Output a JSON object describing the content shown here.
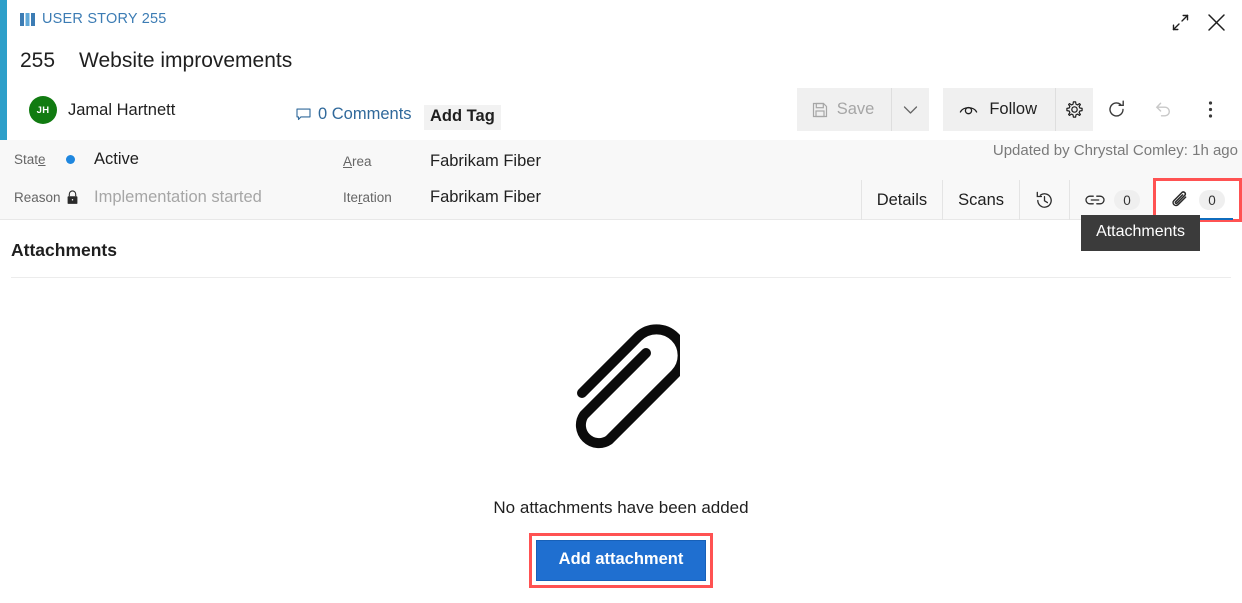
{
  "window": {
    "restore_title": "Restore",
    "close_title": "Close"
  },
  "header": {
    "work_item_type": "USER STORY 255",
    "work_item_id": "255",
    "title": "Website improvements",
    "assignee": "Jamal Hartnett",
    "assignee_initials": "JH",
    "comments_label": "0 Comments",
    "add_tag_label": "Add Tag"
  },
  "toolbar": {
    "save_label": "Save",
    "follow_label": "Follow",
    "save_dropdown_title": "Save options",
    "settings_title": "Settings",
    "refresh_title": "Refresh",
    "undo_title": "Revert",
    "more_title": "More actions"
  },
  "info": {
    "state_label": "State",
    "state_value": "Active",
    "state_color": "#1F87DF",
    "reason_label": "Reason",
    "reason_value": "Implementation started",
    "area_label": "Area",
    "area_value": "Fabrikam Fiber",
    "iteration_label": "Iteration",
    "iteration_value": "Fabrikam Fiber",
    "updated_note": "Updated by Chrystal Comley: 1h ago"
  },
  "tabs": [
    {
      "label": "Details",
      "count": "",
      "icon": "",
      "active": false
    },
    {
      "label": "Scans",
      "count": "",
      "icon": "",
      "active": false
    },
    {
      "label": "",
      "count": "",
      "icon": "history-icon",
      "active": false
    },
    {
      "label": "",
      "count": "0",
      "icon": "link-icon",
      "active": false
    },
    {
      "label": "",
      "count": "0",
      "icon": "paperclip-icon",
      "active": true
    }
  ],
  "tooltip": {
    "text": "Attachments"
  },
  "main": {
    "section_title": "Attachments",
    "empty_icon": "paperclip-icon",
    "empty_text": "No attachments have been added",
    "add_button_label": "Add attachment"
  },
  "colors": {
    "accent_strip": "#2E9FC9",
    "link": "#30699B",
    "avatar": "#117B11",
    "primary_button": "#1F6FD0",
    "highlight_box": "#FF5252",
    "active_tab_underline": "#0F6CBD"
  }
}
